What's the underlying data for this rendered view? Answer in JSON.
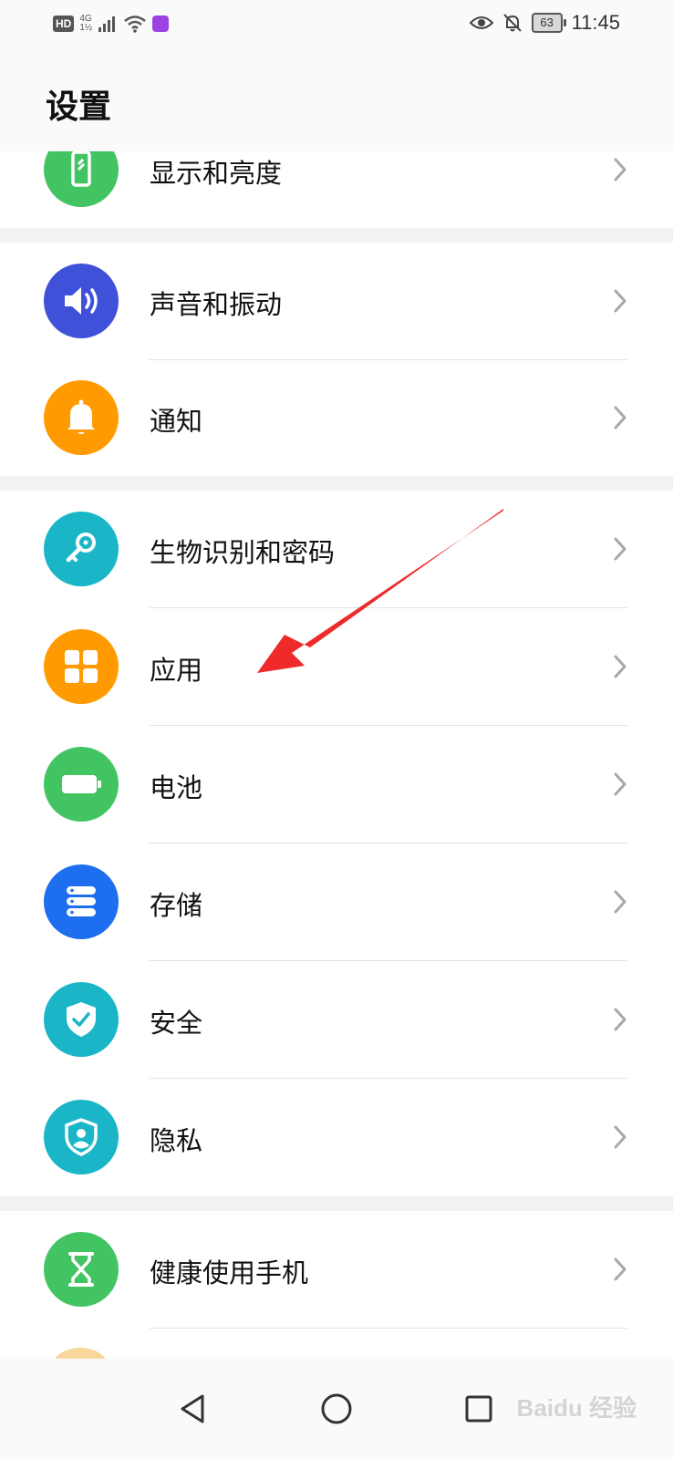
{
  "status_bar": {
    "hd": "HD",
    "network_top": "4G",
    "network_bottom": "1½",
    "battery": "63",
    "time": "11:45",
    "icons": [
      "signal-icon",
      "wifi-icon",
      "app-notification-icon",
      "eye-icon",
      "bell-off-icon",
      "battery-icon"
    ]
  },
  "header": {
    "title": "设置"
  },
  "items": [
    {
      "label": "显示和亮度",
      "icon": "display-phone-icon",
      "color": "#43c463"
    },
    {
      "label": "声音和振动",
      "icon": "speaker-icon",
      "color": "#3f50d9"
    },
    {
      "label": "通知",
      "icon": "bell-icon",
      "color": "#ff9b00"
    },
    {
      "label": "生物识别和密码",
      "icon": "key-icon",
      "color": "#1ab6c8"
    },
    {
      "label": "应用",
      "icon": "apps-grid-icon",
      "color": "#ff9b00"
    },
    {
      "label": "电池",
      "icon": "battery-icon",
      "color": "#43c463"
    },
    {
      "label": "存储",
      "icon": "storage-icon",
      "color": "#1e6ef0"
    },
    {
      "label": "安全",
      "icon": "shield-check-icon",
      "color": "#1ab6c8"
    },
    {
      "label": "隐私",
      "icon": "privacy-shield-icon",
      "color": "#1ab6c8"
    },
    {
      "label": "健康使用手机",
      "icon": "hourglass-icon",
      "color": "#43c463"
    }
  ],
  "nav": {
    "icons": [
      "back-icon",
      "home-icon",
      "recents-icon"
    ]
  },
  "watermark": "Baidu 经验",
  "annotation": {
    "color": "#ee2a2a",
    "target": "应用"
  }
}
